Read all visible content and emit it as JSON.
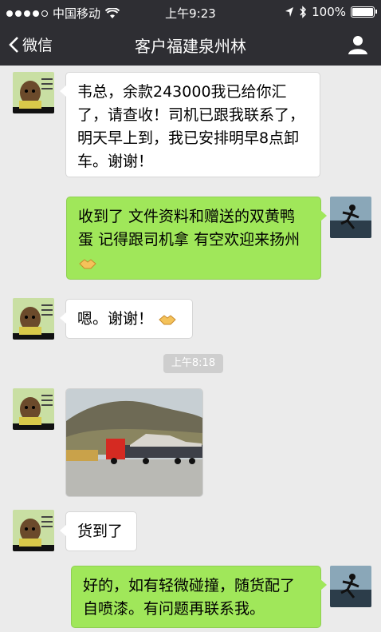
{
  "status_bar": {
    "carrier": "中国移动",
    "time": "上午9:23",
    "battery": "100%"
  },
  "nav": {
    "back_label": "微信",
    "title": "客户福建泉州林"
  },
  "messages": [
    {
      "side": "in",
      "text": "韦总，余款243000我已给你汇了，请查收！司机已跟我联系了，明天早上到，我已安排明早8点卸车。谢谢！"
    },
    {
      "side": "out",
      "text": "收到了 文件资料和赠送的双黄鸭蛋 记得跟司机拿 有空欢迎来扬州"
    },
    {
      "side": "in",
      "text": "嗯。谢谢！"
    },
    {
      "side": "in",
      "text": "货到了"
    },
    {
      "side": "out",
      "text": "好的，如有轻微碰撞，随货配了自喷漆。有问题再联系我。"
    }
  ],
  "timestamp": "上午8:18",
  "colors": {
    "chat_bg": "#ebebeb",
    "nav_bg": "#2e2e33",
    "out_bubble": "#a0e75a",
    "in_bubble": "#ffffff"
  }
}
